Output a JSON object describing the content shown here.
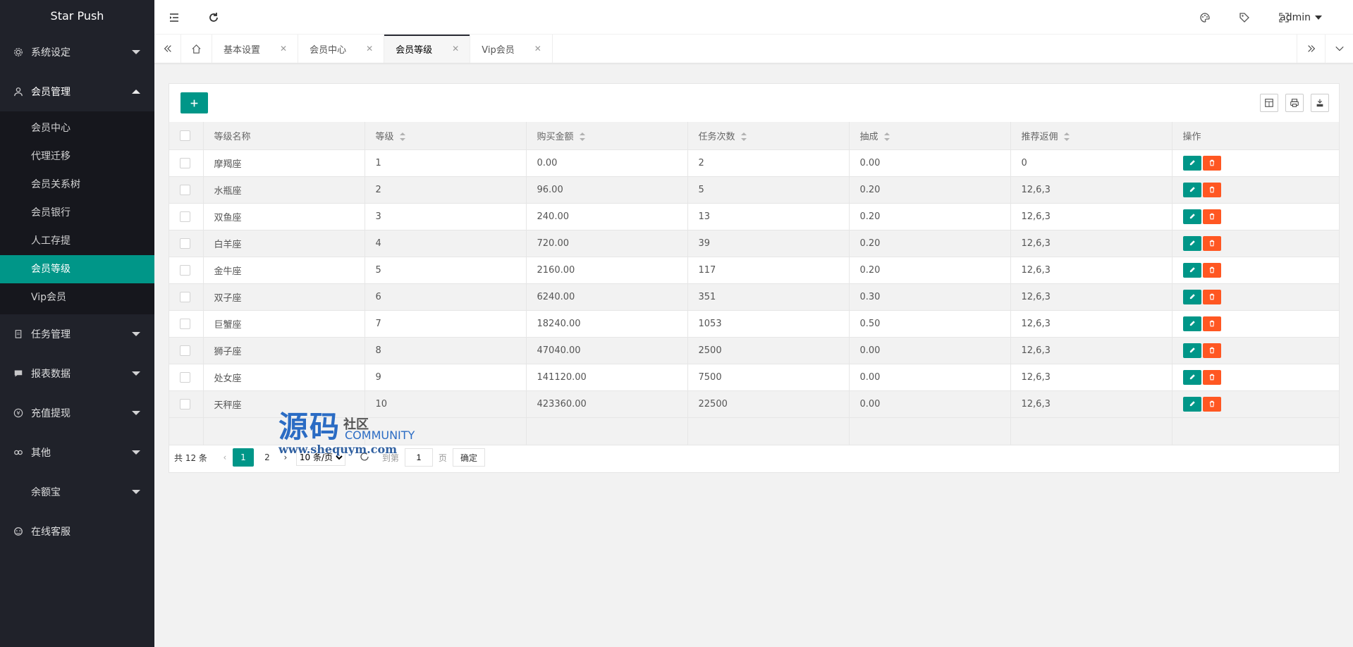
{
  "app": {
    "brand": "Star Push"
  },
  "sidebar": {
    "items": [
      {
        "label": "系统设定",
        "icon": "gear-icon"
      },
      {
        "label": "会员管理",
        "icon": "user-icon"
      },
      {
        "label": "任务管理",
        "icon": "document-icon"
      },
      {
        "label": "报表数据",
        "icon": "chat-icon"
      },
      {
        "label": "充值提现",
        "icon": "yen-icon"
      },
      {
        "label": "其他",
        "icon": "link-icon"
      },
      {
        "label": "余额宝",
        "icon": ""
      },
      {
        "label": "在线客服",
        "icon": "headset-icon"
      }
    ],
    "submenu": [
      "会员中心",
      "代理迁移",
      "会员关系树",
      "会员银行",
      "人工存提",
      "会员等级",
      "Vip会员"
    ],
    "active_sub": "会员等级"
  },
  "header": {
    "user": "admin"
  },
  "tabs": [
    {
      "label": "基本设置",
      "active": false
    },
    {
      "label": "会员中心",
      "active": false
    },
    {
      "label": "会员等级",
      "active": true
    },
    {
      "label": "Vip会员",
      "active": false
    }
  ],
  "table": {
    "columns": [
      "等级名称",
      "等级",
      "购买金额",
      "任务次数",
      "抽成",
      "推荐返佣",
      "操作"
    ],
    "rows": [
      [
        "摩羯座",
        "1",
        "0.00",
        "2",
        "0.00",
        "0"
      ],
      [
        "水瓶座",
        "2",
        "96.00",
        "5",
        "0.20",
        "12,6,3"
      ],
      [
        "双鱼座",
        "3",
        "240.00",
        "13",
        "0.20",
        "12,6,3"
      ],
      [
        "白羊座",
        "4",
        "720.00",
        "39",
        "0.20",
        "12,6,3"
      ],
      [
        "金牛座",
        "5",
        "2160.00",
        "117",
        "0.20",
        "12,6,3"
      ],
      [
        "双子座",
        "6",
        "6240.00",
        "351",
        "0.30",
        "12,6,3"
      ],
      [
        "巨蟹座",
        "7",
        "18240.00",
        "1053",
        "0.50",
        "12,6,3"
      ],
      [
        "狮子座",
        "8",
        "47040.00",
        "2500",
        "0.00",
        "12,6,3"
      ],
      [
        "处女座",
        "9",
        "141120.00",
        "7500",
        "0.00",
        "12,6,3"
      ],
      [
        "天秤座",
        "10",
        "423360.00",
        "22500",
        "0.00",
        "12,6,3"
      ]
    ]
  },
  "pager": {
    "total": "共 12 条",
    "pages": [
      "1",
      "2"
    ],
    "current": "1",
    "page_size": "10 条/页",
    "goto_label": "到第",
    "goto_value": "1",
    "page_unit": "页",
    "confirm": "确定"
  },
  "watermark": {
    "cn": "源码",
    "sub": "社区",
    "en": "COMMUNITY",
    "url": "www.shequym.com"
  },
  "colors": {
    "accent": "#009688",
    "danger": "#ff5722",
    "sidebar_bg": "#20222a"
  }
}
